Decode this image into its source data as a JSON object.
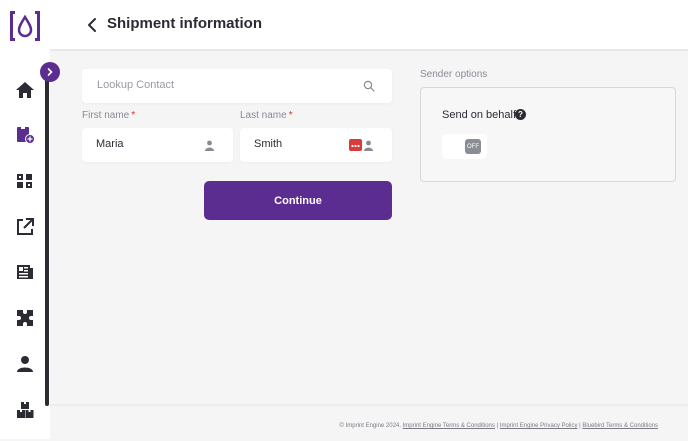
{
  "header": {
    "title": "Shipment information"
  },
  "form": {
    "lookup_placeholder": "Lookup Contact",
    "first_name_label": "First name",
    "last_name_label": "Last name",
    "required_mark": "*",
    "first_name_value": "Maria",
    "last_name_value": "Smith",
    "continue_label": "Continue"
  },
  "sender": {
    "title": "Sender options",
    "send_on_behalf_label": "Send on behalf",
    "help_glyph": "?",
    "toggle_state": "OFF"
  },
  "footer": {
    "copyright": "© Imprint Engine 2024.",
    "terms_link": "Imprint Engine Terms & Conditions",
    "separator": "|",
    "privacy_link": "Imprint Engine Privacy Policy",
    "bluebird_link": "Bluebird Terms & Conditions"
  },
  "colors": {
    "accent": "#5b2d91",
    "required": "#d0342c",
    "text": "#2b2b33"
  },
  "sidebar": {
    "icons": [
      "home-icon",
      "add-order-icon",
      "products-icon",
      "external-link-icon",
      "newspaper-icon",
      "puzzle-icon",
      "user-icon",
      "inventory-icon"
    ]
  }
}
